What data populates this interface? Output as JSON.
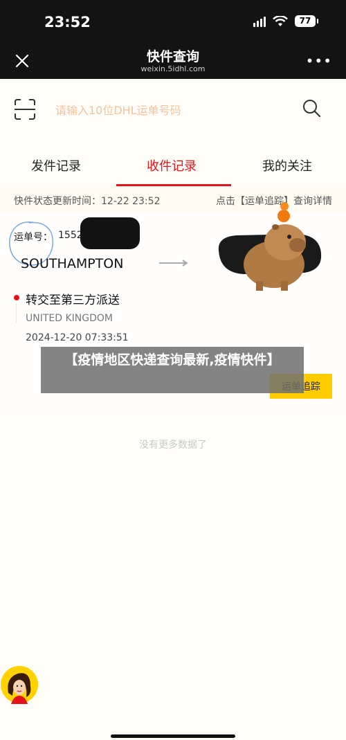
{
  "status_bar": {
    "time": "23:52",
    "battery": "77"
  },
  "nav": {
    "title": "快件查询",
    "subtitle": "weixin.5idhl.com",
    "more": "•••"
  },
  "search": {
    "placeholder": "请输入10位DHL运单号码"
  },
  "tabs": [
    {
      "label": "发件记录"
    },
    {
      "label": "收件记录"
    },
    {
      "label": "我的关注"
    }
  ],
  "info": {
    "update_label": "快件状态更新时间：12-22 23:52",
    "detail_link": "点击【运单追踪】查询详情"
  },
  "shipment": {
    "waybill_label": "运单号：",
    "waybill_number": "1552",
    "city": "SOUTHAMPTON",
    "status": "转交至第三方派送",
    "location": "UNITED KINGDOM",
    "timestamp": "2024-12-20 07:33:51",
    "track_button": "运单追踪"
  },
  "overlay": {
    "text": "【疫情地区快递查询最新,疫情快件】"
  },
  "footer": {
    "no_more": "没有更多数据了"
  },
  "colors": {
    "accent": "#e3131b",
    "button": "#ffcc00",
    "dark_bar": "#131313"
  }
}
